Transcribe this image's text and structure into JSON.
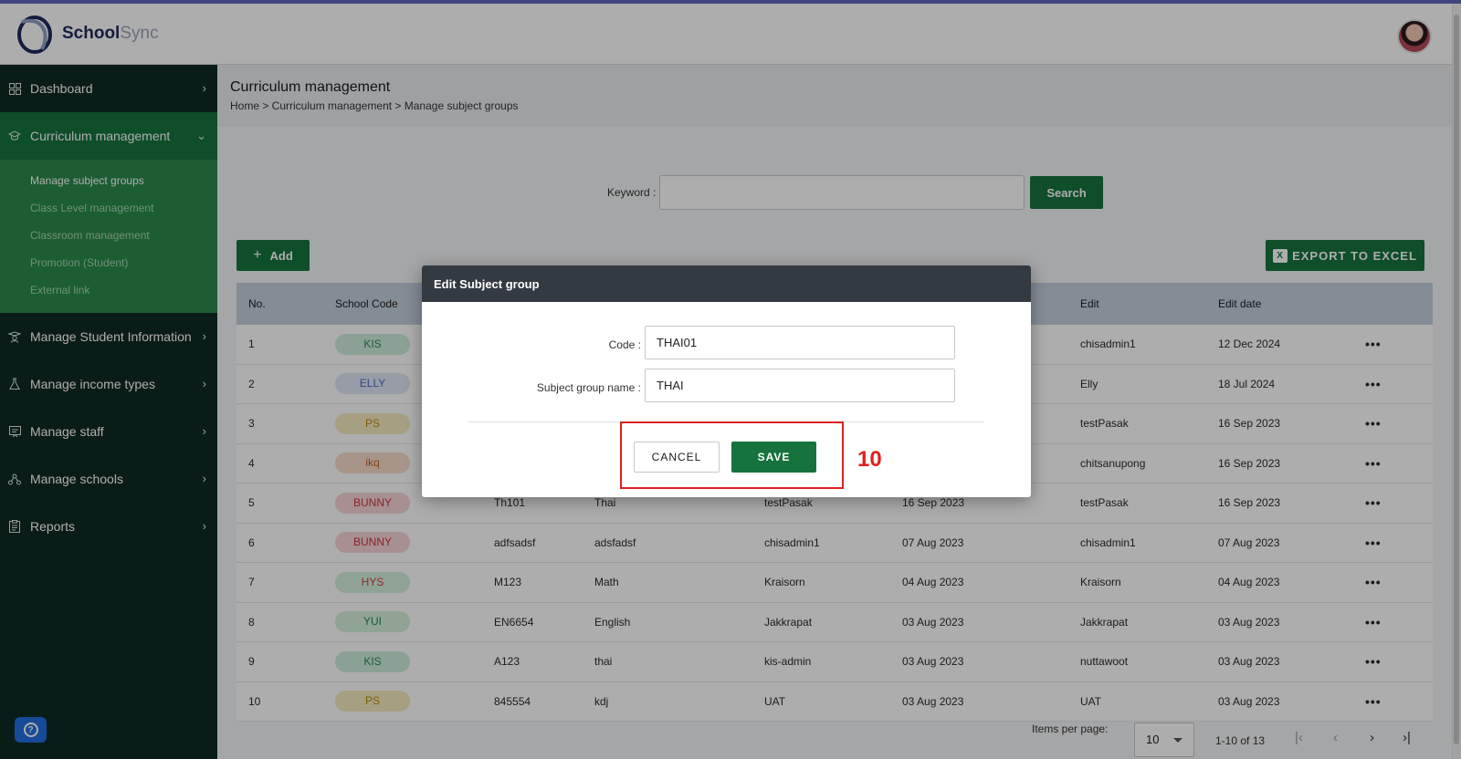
{
  "app": {
    "logo_primary": "School",
    "logo_secondary": "Sync"
  },
  "sidebar": {
    "items": [
      {
        "label": "Dashboard",
        "icon": "grid-icon"
      },
      {
        "label": "Curriculum management",
        "icon": "graduation-cap-icon"
      },
      {
        "label": "Manage Student Information",
        "icon": "student-icon"
      },
      {
        "label": "Manage income types",
        "icon": "flask-icon"
      },
      {
        "label": "Manage staff",
        "icon": "staff-board-icon"
      },
      {
        "label": "Manage schools",
        "icon": "school-network-icon"
      },
      {
        "label": "Reports",
        "icon": "clipboard-icon"
      }
    ],
    "submenu": [
      "Manage subject groups",
      "Class Level management",
      "Classroom management",
      "Promotion (Student)",
      "External link"
    ]
  },
  "page": {
    "title": "Curriculum management",
    "breadcrumb": "Home > Curriculum management > Manage subject groups"
  },
  "search": {
    "label": "Keyword :",
    "value": "",
    "button": "Search"
  },
  "toolbar": {
    "add_label": "Add",
    "export_label": "EXPORT TO EXCEL"
  },
  "table": {
    "headers": {
      "no": "No.",
      "school": "School Code",
      "edit": "Edit",
      "edit_date": "Edit date"
    },
    "rows": [
      {
        "no": "1",
        "school": "KIS",
        "code": "",
        "name": "",
        "creator": "",
        "created": "",
        "edit": "chisadmin1",
        "edit_date": "12 Dec 2024"
      },
      {
        "no": "2",
        "school": "ELLY",
        "code": "",
        "name": "",
        "creator": "",
        "created": "",
        "edit": "Elly",
        "edit_date": "18 Jul 2024"
      },
      {
        "no": "3",
        "school": "PS",
        "code": "",
        "name": "",
        "creator": "",
        "created": "",
        "edit": "testPasak",
        "edit_date": "16 Sep 2023"
      },
      {
        "no": "4",
        "school": "ikq",
        "code": "",
        "name": "",
        "creator": "",
        "created": "",
        "edit": "chitsanupong",
        "edit_date": "16 Sep 2023"
      },
      {
        "no": "5",
        "school": "BUNNY",
        "code": "Th101",
        "name": "Thai",
        "creator": "testPasak",
        "created": "16 Sep 2023",
        "edit": "testPasak",
        "edit_date": "16 Sep 2023"
      },
      {
        "no": "6",
        "school": "BUNNY",
        "code": "adfsadsf",
        "name": "adsfadsf",
        "creator": "chisadmin1",
        "created": "07 Aug 2023",
        "edit": "chisadmin1",
        "edit_date": "07 Aug 2023"
      },
      {
        "no": "7",
        "school": "HYS",
        "code": "M123",
        "name": "Math",
        "creator": "Kraisorn",
        "created": "04 Aug 2023",
        "edit": "Kraisorn",
        "edit_date": "04 Aug 2023"
      },
      {
        "no": "8",
        "school": "YUI",
        "code": "EN6654",
        "name": "English",
        "creator": "Jakkrapat",
        "created": "03 Aug 2023",
        "edit": "Jakkrapat",
        "edit_date": "03 Aug 2023"
      },
      {
        "no": "9",
        "school": "KIS",
        "code": "A123",
        "name": "thai",
        "creator": "kis-admin",
        "created": "03 Aug 2023",
        "edit": "nuttawoot",
        "edit_date": "03 Aug 2023"
      },
      {
        "no": "10",
        "school": "PS",
        "code": "845554",
        "name": "kdj",
        "creator": "UAT",
        "created": "03 Aug 2023",
        "edit": "UAT",
        "edit_date": "03 Aug 2023"
      }
    ],
    "more_glyph": "•••"
  },
  "badge_colors": {
    "KIS": {
      "bg": "#cdeedd",
      "fg": "#2d8a55"
    },
    "ELLY": {
      "bg": "#dfe6f5",
      "fg": "#4a6fc4"
    },
    "PS": {
      "bg": "#f6ebbf",
      "fg": "#b58a16"
    },
    "ikq": {
      "bg": "#f8dccb",
      "fg": "#c0622a"
    },
    "BUNNY": {
      "bg": "#f8d3d6",
      "fg": "#c9343f"
    },
    "HYS": {
      "bg": "#d2f0dc",
      "fg": "#d24141"
    },
    "YUI": {
      "bg": "#d4f0dc",
      "fg": "#2d8a55"
    }
  },
  "pagination": {
    "items_label": "Items per page:",
    "per_page": "10",
    "range": "1-10 of 13"
  },
  "modal": {
    "title": "Edit Subject group",
    "code_label": "Code :",
    "code_value": "THAI01",
    "name_label": "Subject group name :",
    "name_value": "THAI",
    "cancel_label": "CANCEL",
    "save_label": "SAVE"
  },
  "annotation": {
    "step": "10",
    "color": "#e02020"
  },
  "colors": {
    "primary_green": "#16733d",
    "sidebar_bg": "#0f2a22",
    "header_accent": "#5f66b8"
  }
}
